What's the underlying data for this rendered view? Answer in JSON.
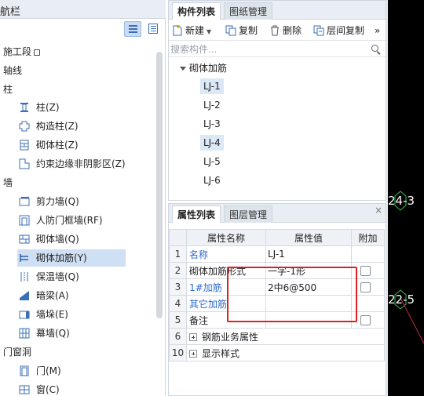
{
  "nav": {
    "title": "航栏",
    "categories": {
      "construction": "施工段",
      "axis": "轴线",
      "column": "柱",
      "wall": "墙",
      "opening": "门窗洞"
    },
    "items": {
      "column": "柱(Z)",
      "structural_column": "构造柱(Z)",
      "masonry_column": "砌体柱(Z)",
      "constraint_edge": "约束边缘非阴影区(Z)",
      "shear_wall": "剪力墙(Q)",
      "civil_defense": "人防门框墙(RF)",
      "masonry_wall": "砌体墙(Q)",
      "masonry_rebar": "砌体加筋(Y)",
      "insulation_wall": "保温墙(Q)",
      "hidden_beam": "暗梁(A)",
      "wall_pier": "墙垛(E)",
      "curtain_wall": "幕墙(Q)",
      "door": "门(M)",
      "window": "窗(C)"
    }
  },
  "component_panel": {
    "tabs": [
      "构件列表",
      "图纸管理"
    ],
    "toolbar": {
      "new": "新建",
      "copy": "复制",
      "delete": "删除",
      "floor_copy": "层间复制",
      "more": "»"
    },
    "search_placeholder": "搜索构件...",
    "tree_root": "砌体加筋",
    "items": [
      "LJ-1",
      "LJ-2",
      "LJ-3",
      "LJ-4",
      "LJ-5",
      "LJ-6"
    ]
  },
  "property_panel": {
    "tabs": [
      "属性列表",
      "图层管理"
    ],
    "close": "×",
    "headers": [
      "属性名称",
      "属性值",
      "附加"
    ],
    "rows": [
      {
        "num": "1",
        "name": "名称",
        "value": "LJ-1"
      },
      {
        "num": "2",
        "name": "砌体加筋形式",
        "value": "一字-1形"
      },
      {
        "num": "3",
        "name": "1#加筋",
        "value": "2中6@500"
      },
      {
        "num": "4",
        "name": "其它加筋",
        "value": ""
      },
      {
        "num": "5",
        "name": "备注",
        "value": ""
      },
      {
        "num": "6",
        "name": "钢筋业务属性",
        "value": ""
      },
      {
        "num": "10",
        "name": "显示样式",
        "value": ""
      }
    ]
  },
  "canvas": {
    "axis_labels": [
      "24-3",
      "22-5"
    ]
  },
  "colors": {
    "selected": "#cfe0f4",
    "link": "#2d6ad0",
    "highlight_box": "#e02020",
    "canvas": "#000000"
  }
}
